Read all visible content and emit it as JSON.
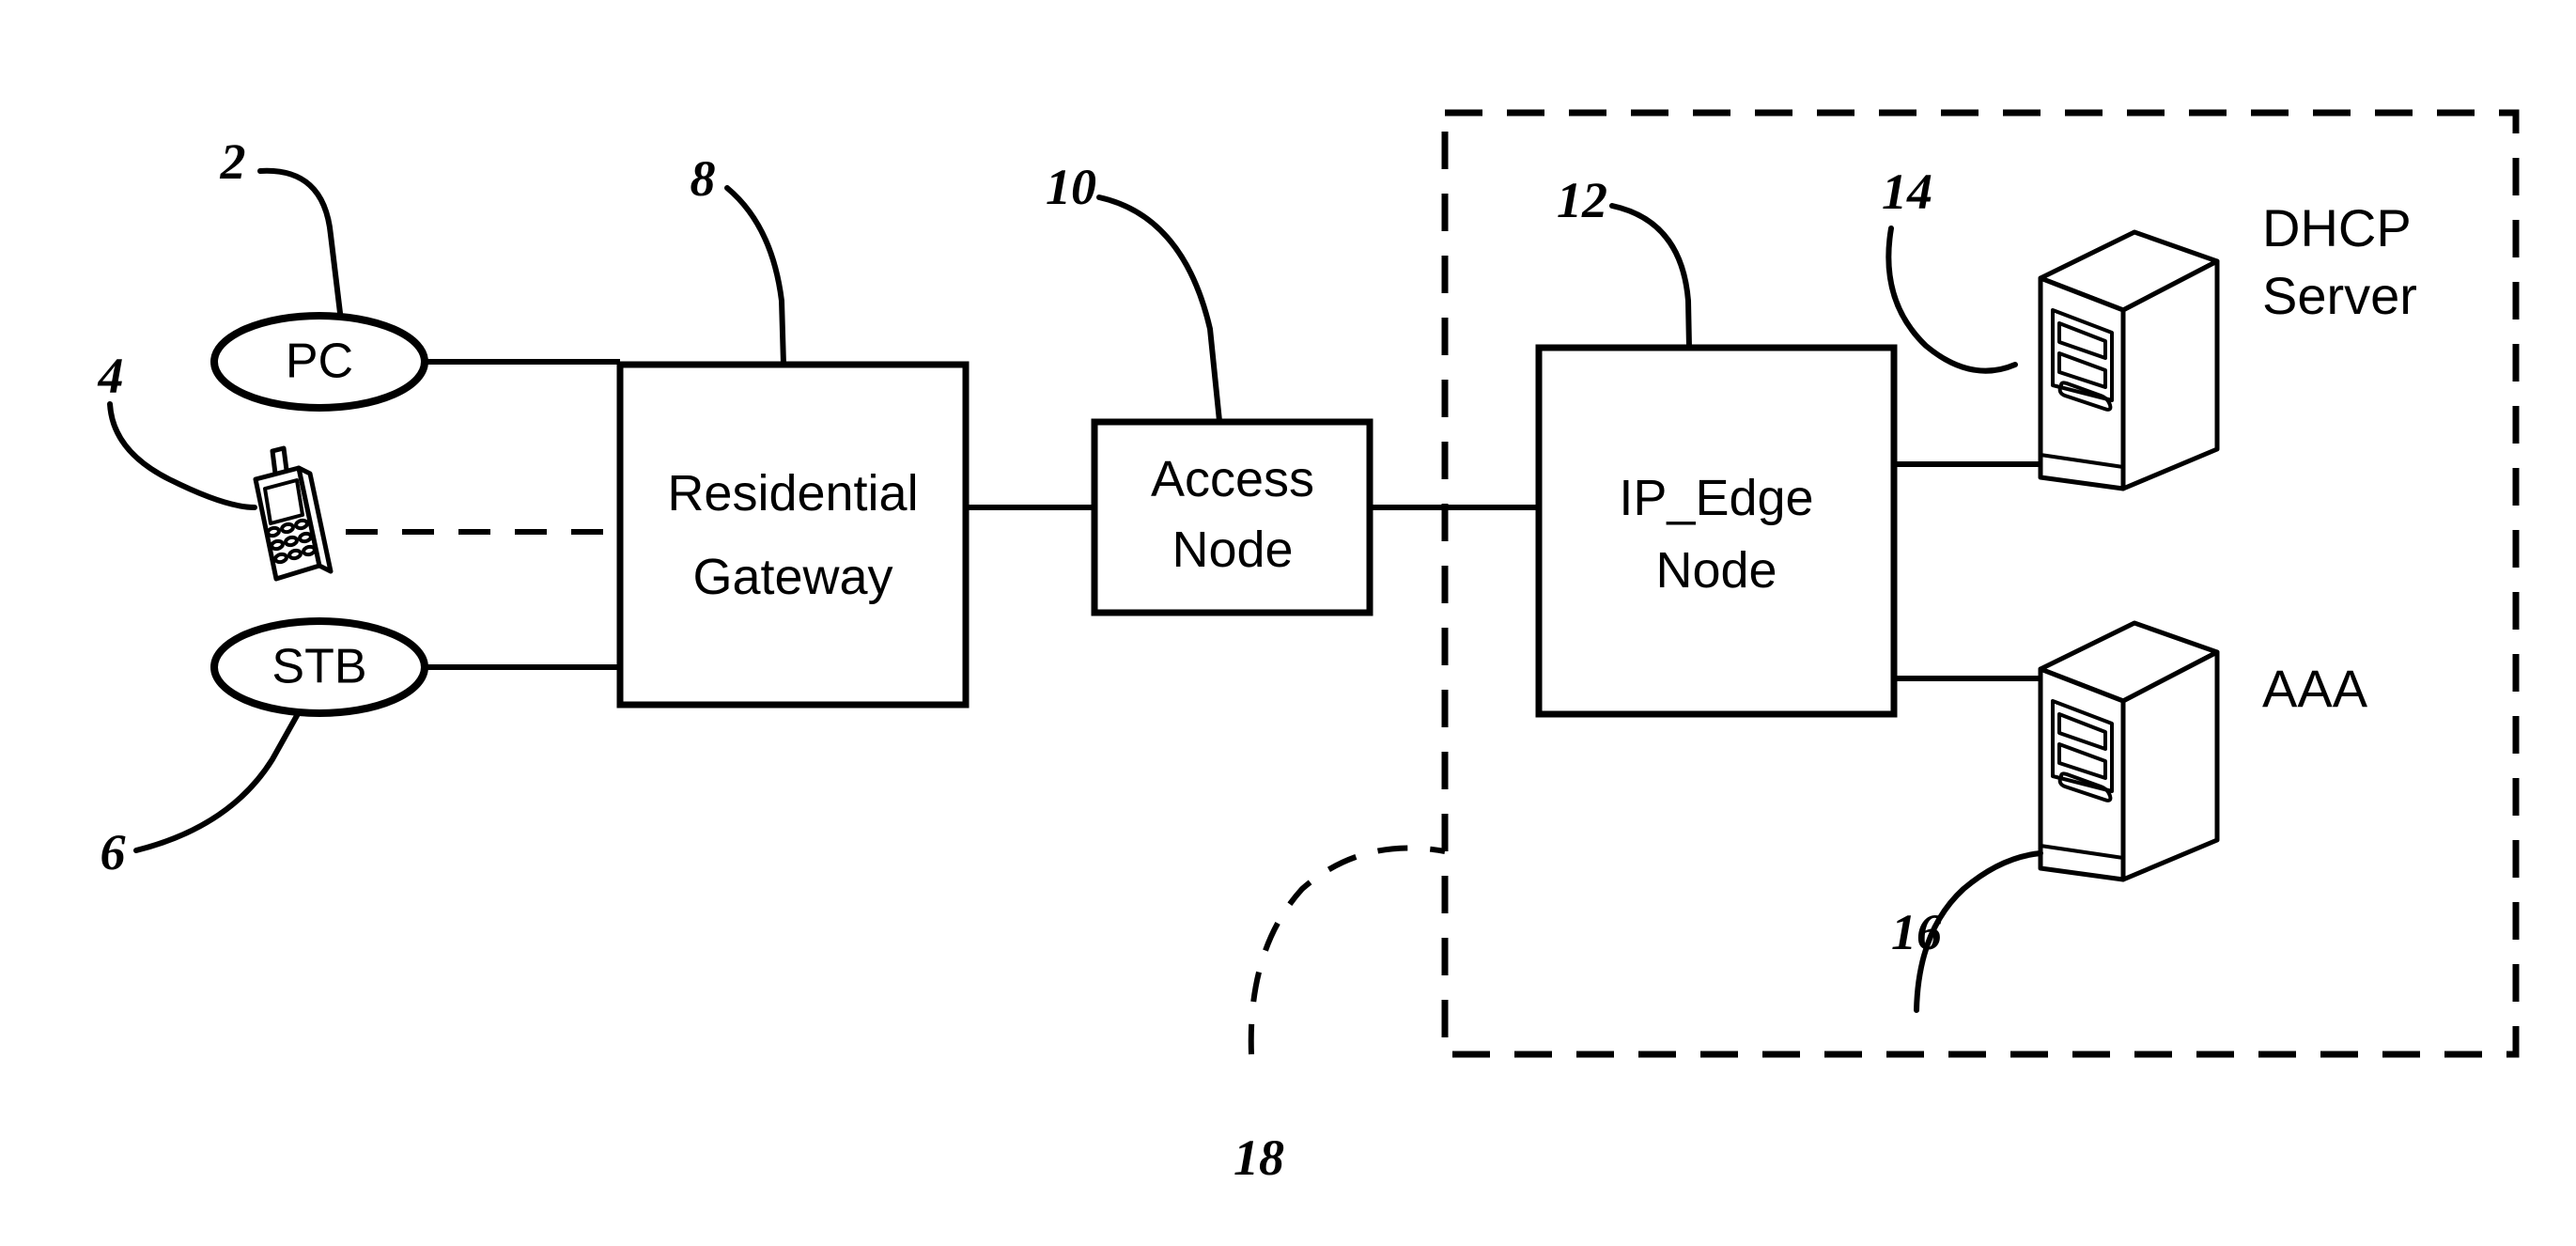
{
  "figure": {
    "type": "patent-network-diagram",
    "title": "Residential broadband access network architecture",
    "background_color": "#ffffff",
    "line_color": "#000000"
  },
  "nodes": {
    "pc": {
      "label": "PC",
      "shape": "ellipse",
      "ref": "2"
    },
    "mobile": {
      "label": "",
      "shape": "mobile-phone-icon",
      "ref": "4"
    },
    "stb": {
      "label": "STB",
      "shape": "ellipse",
      "ref": "6"
    },
    "residential_gateway": {
      "label_line1": "Residential",
      "label_line2": "Gateway",
      "shape": "rectangle",
      "ref": "8"
    },
    "access_node": {
      "label_line1": "Access",
      "label_line2": "Node",
      "shape": "rectangle",
      "ref": "10"
    },
    "ip_edge_node": {
      "label_line1": "IP_Edge",
      "label_line2": "Node",
      "shape": "rectangle",
      "ref": "12"
    },
    "dhcp_server": {
      "label_line1": "DHCP",
      "label_line2": "Server",
      "shape": "server-tower-icon",
      "ref": "14"
    },
    "aaa_server": {
      "label_line1": "AAA",
      "label_line2": "",
      "shape": "server-tower-icon",
      "ref": "16"
    },
    "network_boundary": {
      "label": "",
      "shape": "dashed-rectangle",
      "ref": "18"
    }
  },
  "reference_numerals": [
    {
      "id": "ref-2",
      "value": "2",
      "target": "pc"
    },
    {
      "id": "ref-4",
      "value": "4",
      "target": "mobile"
    },
    {
      "id": "ref-6",
      "value": "6",
      "target": "stb"
    },
    {
      "id": "ref-8",
      "value": "8",
      "target": "residential_gateway"
    },
    {
      "id": "ref-10",
      "value": "10",
      "target": "access_node"
    },
    {
      "id": "ref-12",
      "value": "12",
      "target": "ip_edge_node"
    },
    {
      "id": "ref-14",
      "value": "14",
      "target": "dhcp_server"
    },
    {
      "id": "ref-16",
      "value": "16",
      "target": "aaa_server"
    },
    {
      "id": "ref-18",
      "value": "18",
      "target": "network_boundary"
    }
  ],
  "connections": [
    {
      "from": "pc",
      "to": "residential_gateway",
      "style": "solid"
    },
    {
      "from": "mobile",
      "to": "residential_gateway",
      "style": "dashed"
    },
    {
      "from": "stb",
      "to": "residential_gateway",
      "style": "solid"
    },
    {
      "from": "residential_gateway",
      "to": "access_node",
      "style": "solid"
    },
    {
      "from": "access_node",
      "to": "ip_edge_node",
      "style": "solid"
    },
    {
      "from": "ip_edge_node",
      "to": "dhcp_server",
      "style": "solid"
    },
    {
      "from": "ip_edge_node",
      "to": "aaa_server",
      "style": "solid"
    }
  ]
}
